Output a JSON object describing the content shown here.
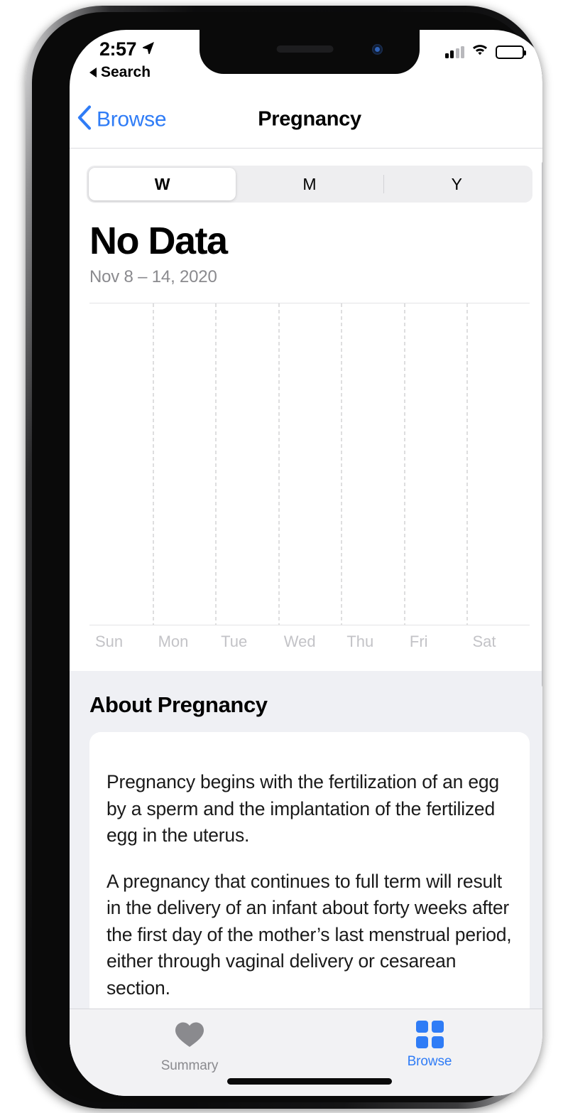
{
  "status_bar": {
    "time": "2:57",
    "location_icon": "location-arrow-icon",
    "signal_icon": "cellular-signal-icon",
    "signal_bars_filled": 2,
    "signal_bars_total": 4,
    "wifi_icon": "wifi-icon",
    "battery_icon": "battery-full-icon",
    "back_to_app_label": "Search",
    "back_to_app_icon": "triangle-left-icon"
  },
  "nav_bar": {
    "back_label": "Browse",
    "back_icon": "chevron-left-icon",
    "title": "Pregnancy"
  },
  "segmented_control": {
    "options": [
      {
        "label": "W",
        "selected": true
      },
      {
        "label": "M",
        "selected": false
      },
      {
        "label": "Y",
        "selected": false
      }
    ]
  },
  "stat": {
    "value": "No Data",
    "date_range": "Nov 8 – 14, 2020"
  },
  "chart_data": {
    "type": "bar",
    "title": "No Data",
    "subtitle": "Nov 8 – 14, 2020",
    "categories": [
      "Sun",
      "Mon",
      "Tue",
      "Wed",
      "Thu",
      "Fri",
      "Sat"
    ],
    "values": [
      null,
      null,
      null,
      null,
      null,
      null,
      null
    ],
    "xlabel": "",
    "ylabel": "",
    "grid": true,
    "legend": "none",
    "empty_state": true
  },
  "about": {
    "title": "About Pregnancy",
    "paragraphs": [
      "Pregnancy begins with the fertilization of an egg by a sperm and the implantation of the fertilized egg in the uterus.",
      "A pregnancy that continues to full term will result in the delivery of an infant about forty weeks after the first day of the mother’s last menstrual period, either through vaginal delivery or cesarean section."
    ]
  },
  "tab_bar": {
    "tabs": [
      {
        "label": "Summary",
        "icon": "heart-icon",
        "active": false
      },
      {
        "label": "Browse",
        "icon": "grid-squares-icon",
        "active": true
      }
    ]
  },
  "colors": {
    "accent": "#2f7cf6",
    "inactive": "#8a8a8e",
    "section_background": "#eff0f4",
    "segment_track": "#eeeef0"
  }
}
